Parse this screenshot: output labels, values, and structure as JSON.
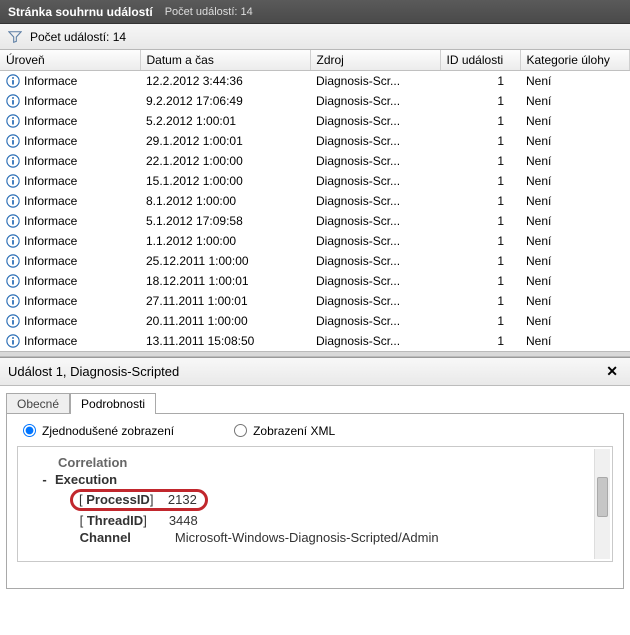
{
  "titlebar": {
    "title": "Stránka souhrnu událostí",
    "subtitle": "Počet událostí: 14"
  },
  "filter": {
    "label": "Počet událostí: 14"
  },
  "columns": {
    "level": "Úroveň",
    "datetime": "Datum a čas",
    "source": "Zdroj",
    "id": "ID události",
    "category": "Kategorie úlohy"
  },
  "rows": [
    {
      "level": "Informace",
      "dt": "12.2.2012 3:44:36",
      "src": "Diagnosis-Scr...",
      "id": "1",
      "cat": "Není"
    },
    {
      "level": "Informace",
      "dt": "9.2.2012 17:06:49",
      "src": "Diagnosis-Scr...",
      "id": "1",
      "cat": "Není"
    },
    {
      "level": "Informace",
      "dt": "5.2.2012 1:00:01",
      "src": "Diagnosis-Scr...",
      "id": "1",
      "cat": "Není"
    },
    {
      "level": "Informace",
      "dt": "29.1.2012 1:00:01",
      "src": "Diagnosis-Scr...",
      "id": "1",
      "cat": "Není"
    },
    {
      "level": "Informace",
      "dt": "22.1.2012 1:00:00",
      "src": "Diagnosis-Scr...",
      "id": "1",
      "cat": "Není"
    },
    {
      "level": "Informace",
      "dt": "15.1.2012 1:00:00",
      "src": "Diagnosis-Scr...",
      "id": "1",
      "cat": "Není"
    },
    {
      "level": "Informace",
      "dt": "8.1.2012 1:00:00",
      "src": "Diagnosis-Scr...",
      "id": "1",
      "cat": "Není"
    },
    {
      "level": "Informace",
      "dt": "5.1.2012 17:09:58",
      "src": "Diagnosis-Scr...",
      "id": "1",
      "cat": "Není"
    },
    {
      "level": "Informace",
      "dt": "1.1.2012 1:00:00",
      "src": "Diagnosis-Scr...",
      "id": "1",
      "cat": "Není"
    },
    {
      "level": "Informace",
      "dt": "25.12.2011 1:00:00",
      "src": "Diagnosis-Scr...",
      "id": "1",
      "cat": "Není"
    },
    {
      "level": "Informace",
      "dt": "18.12.2011 1:00:01",
      "src": "Diagnosis-Scr...",
      "id": "1",
      "cat": "Není"
    },
    {
      "level": "Informace",
      "dt": "27.11.2011 1:00:01",
      "src": "Diagnosis-Scr...",
      "id": "1",
      "cat": "Není"
    },
    {
      "level": "Informace",
      "dt": "20.11.2011 1:00:00",
      "src": "Diagnosis-Scr...",
      "id": "1",
      "cat": "Není"
    },
    {
      "level": "Informace",
      "dt": "13.11.2011 15:08:50",
      "src": "Diagnosis-Scr...",
      "id": "1",
      "cat": "Není"
    }
  ],
  "detail": {
    "header": "Událost 1, Diagnosis-Scripted",
    "tabs": {
      "general": "Obecné",
      "details": "Podrobnosti"
    },
    "view_friendly": "Zjednodušené zobrazení",
    "view_xml": "Zobrazení XML",
    "tree": {
      "correlation": "Correlation",
      "execution": "Execution",
      "process_key": "ProcessID",
      "process_val": "2132",
      "thread_key": "ThreadID",
      "thread_val": "3448",
      "channel_key": "Channel",
      "channel_val": "Microsoft-Windows-Diagnosis-Scripted/Admin"
    }
  }
}
